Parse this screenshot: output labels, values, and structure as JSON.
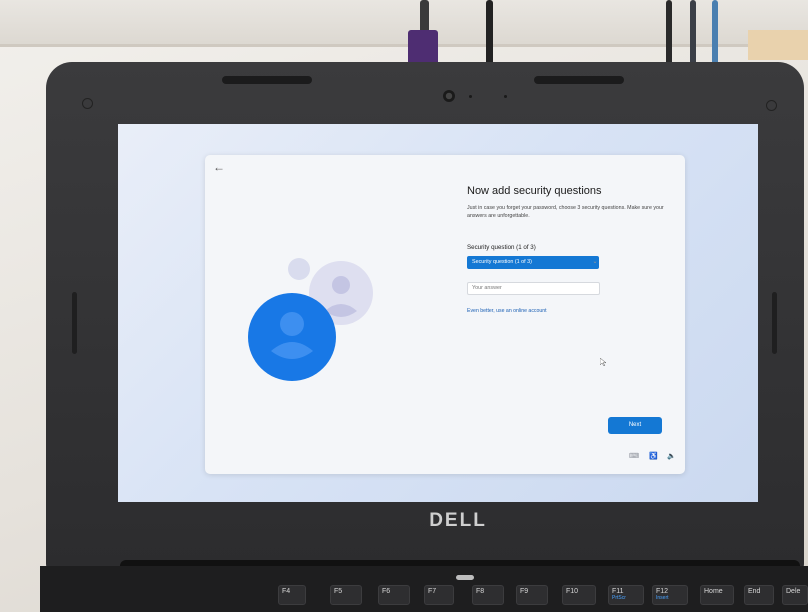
{
  "device": {
    "brand": "DELL"
  },
  "oobe": {
    "back_icon": "back-arrow-icon",
    "title": "Now add security questions",
    "description": "Just in case you forget your password, choose 3 security questions. Make sure your answers are unforgettable.",
    "question_label": "Security question (1 of 3)",
    "question_select_value": "Security question (1 of 3)",
    "answer_placeholder": "Your answer",
    "online_account_link": "Even better, use an online account",
    "next_label": "Next",
    "accent_color": "#1478d4"
  },
  "tray_icons": [
    "keyboard-icon",
    "accessibility-icon",
    "volume-icon"
  ],
  "keyboard": {
    "keys": [
      {
        "label": "F4",
        "sub": ""
      },
      {
        "label": "F5",
        "sub": ""
      },
      {
        "label": "F6",
        "sub": ""
      },
      {
        "label": "F7",
        "sub": ""
      },
      {
        "label": "F8",
        "sub": ""
      },
      {
        "label": "F9",
        "sub": ""
      },
      {
        "label": "F10",
        "sub": ""
      },
      {
        "label": "F11",
        "sub": "PrtScr"
      },
      {
        "label": "F12",
        "sub": "Insert"
      },
      {
        "label": "Home",
        "sub": ""
      },
      {
        "label": "End",
        "sub": ""
      },
      {
        "label": "Dele",
        "sub": ""
      }
    ]
  }
}
